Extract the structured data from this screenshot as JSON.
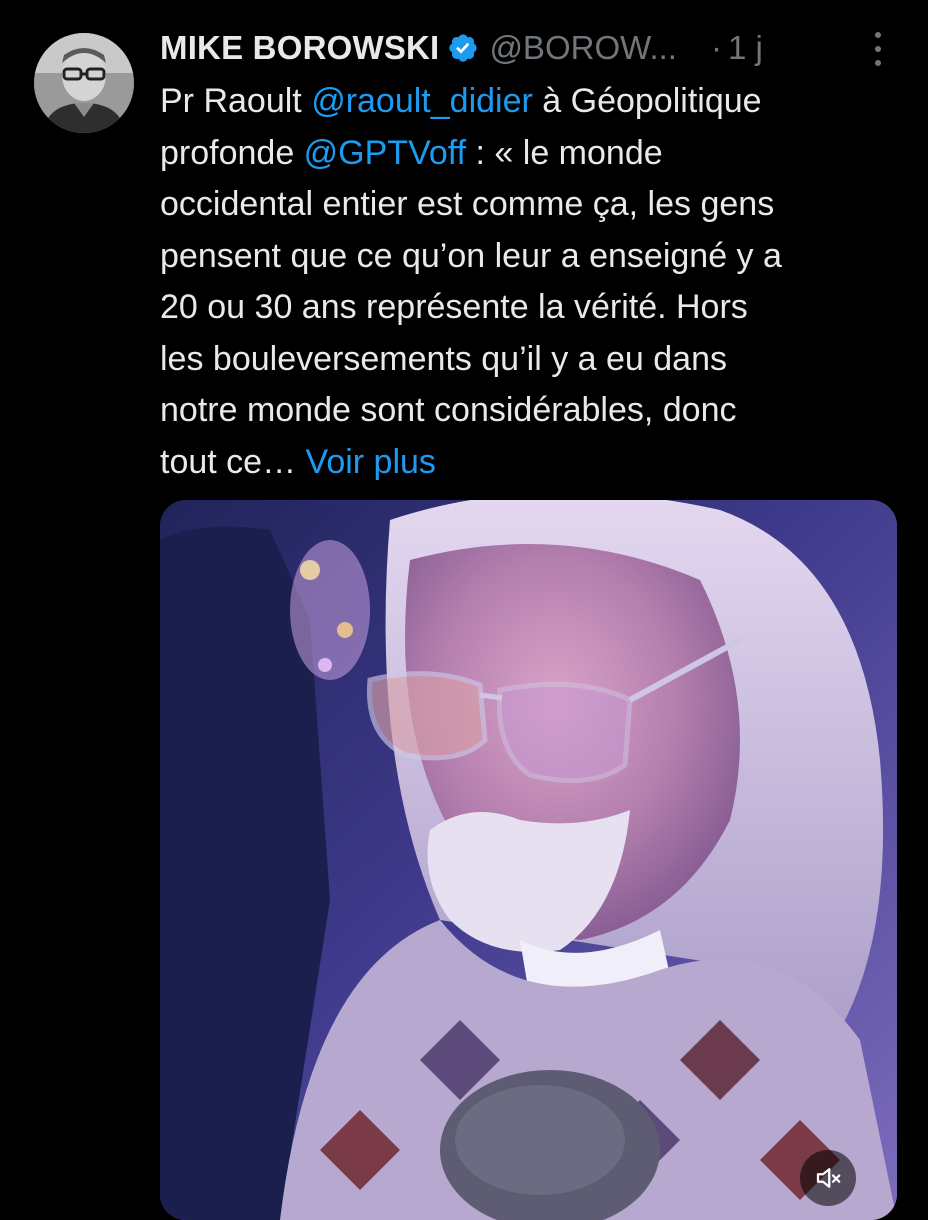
{
  "tweet": {
    "author_name": "MIKE BOROWSKI",
    "handle": "@BOROW...",
    "dot": "·",
    "time": "1 j",
    "text_intro": "Pr Raoult ",
    "mention_1": "@raoult_didier",
    "text_mid": " à Géopolitique\nprofonde ",
    "mention_2": "@GPTVoff",
    "text_body": " : « le monde\noccidental entier est comme ça, les gens\npensent que ce qu’on leur a enseigné y a\n20 ou 30 ans représente la vérité. Hors\nles bouleversements qu’il y a eu dans\nnotre monde sont considérables, donc\ntout ce… ",
    "show_more": "Voir plus"
  },
  "icons": {
    "verified": "verified-badge-icon",
    "more": "more-options-icon",
    "mute": "volume-muted-icon"
  },
  "colors": {
    "background": "#000000",
    "text": "#e7e9ea",
    "secondary": "#71767b",
    "accent": "#1d9bf0"
  }
}
